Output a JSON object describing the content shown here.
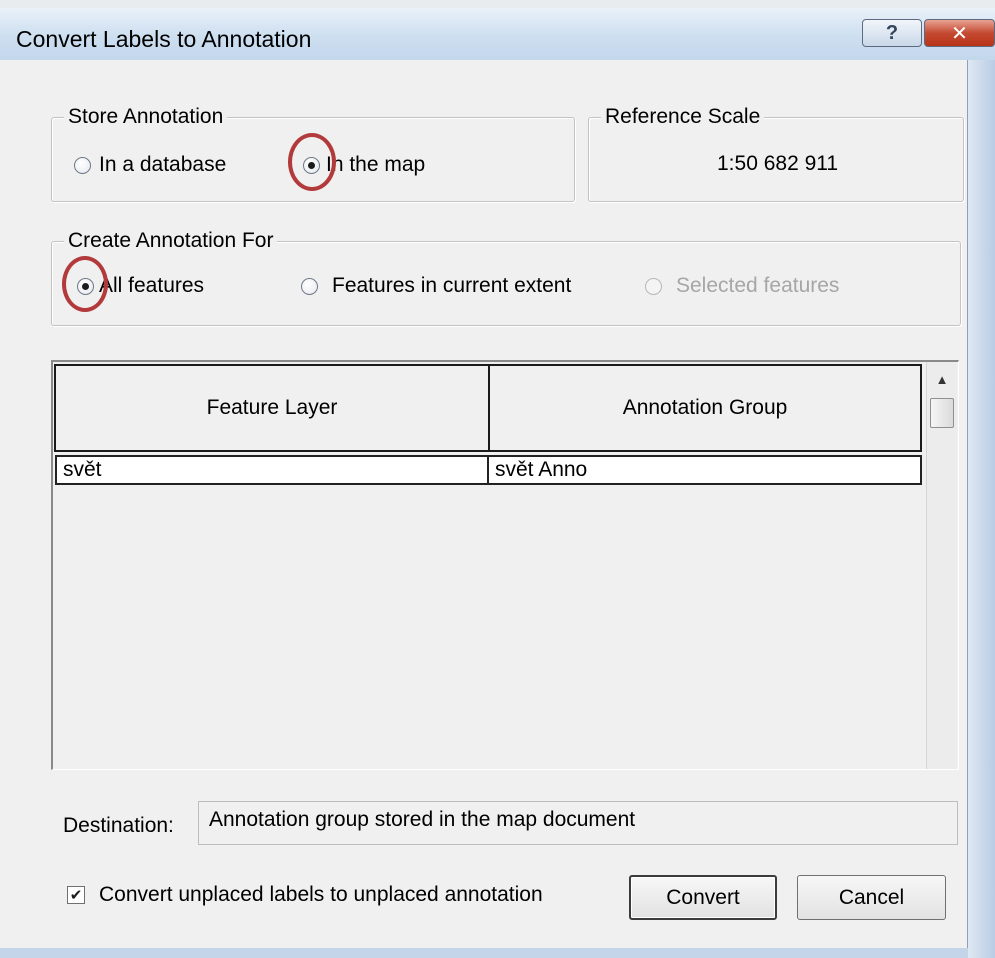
{
  "window": {
    "title": "Convert Labels to Annotation",
    "help_glyph": "?",
    "close_glyph": "✕"
  },
  "store_annotation": {
    "legend": "Store Annotation",
    "options": [
      {
        "label": "In a database",
        "checked": false
      },
      {
        "label": "In the map",
        "checked": true
      }
    ]
  },
  "reference_scale": {
    "legend": "Reference Scale",
    "value": "1:50 682 911"
  },
  "create_for": {
    "legend": "Create Annotation For",
    "options": [
      {
        "label": "All features",
        "checked": true,
        "enabled": true
      },
      {
        "label": "Features in current extent",
        "checked": false,
        "enabled": true
      },
      {
        "label": "Selected features",
        "checked": false,
        "enabled": false
      }
    ]
  },
  "table": {
    "columns": [
      "Feature Layer",
      "Annotation Group"
    ],
    "rows": [
      [
        "svět",
        "svět Anno"
      ]
    ]
  },
  "destination": {
    "label": "Destination:",
    "value": "Annotation group stored in the map document"
  },
  "options": {
    "unplaced_label": "Convert unplaced labels to unplaced annotation",
    "unplaced_checked": true
  },
  "buttons": {
    "convert": "Convert",
    "cancel": "Cancel"
  },
  "colors": {
    "highlight": "#b23a3a",
    "close_button": "#c54a32"
  },
  "icons": {
    "help": "question-mark-icon",
    "close": "close-icon",
    "scroll_up": "chevron-up-icon",
    "check": "checkmark-icon"
  }
}
